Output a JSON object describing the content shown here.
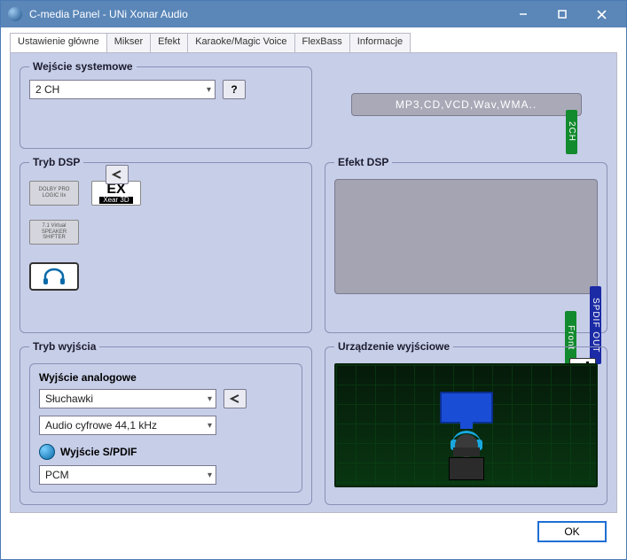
{
  "window": {
    "title": "C-media Panel - UNi Xonar Audio",
    "icon": "audio-app-icon"
  },
  "tabs": [
    {
      "label": "Ustawienie główne",
      "active": true
    },
    {
      "label": "Mikser"
    },
    {
      "label": "Efekt"
    },
    {
      "label": "Karaoke/Magic Voice"
    },
    {
      "label": "FlexBass"
    },
    {
      "label": "Informacje"
    }
  ],
  "system_input": {
    "legend": "Wejście systemowe",
    "channel_value": "2 CH"
  },
  "formats_text": "MP3,CD,VCD,Wav,WMA..",
  "dsp_mode": {
    "legend": "Tryb DSP",
    "buttons": {
      "dolby": "DOLBY PRO LOGIC IIx",
      "xear_top": "EX",
      "xear_bottom": "Xear 3D",
      "virtual71": "7.1 Virtual SPEAKER SHIFTER"
    }
  },
  "dsp_effect": {
    "legend": "Efekt DSP"
  },
  "connectors": {
    "ch2": "2CH",
    "front": "Front",
    "spdif": "SPDIF OUT"
  },
  "output_mode": {
    "legend": "Tryb wyjścia",
    "analog_label": "Wyjście analogowe",
    "analog_value": "Słuchawki",
    "sample_value": "Audio cyfrowe 44,1 kHz",
    "spdif_label": "Wyjście S/PDIF",
    "spdif_value": "PCM"
  },
  "output_device": {
    "legend": "Urządzenie wyjściowe"
  },
  "footer": {
    "ok": "OK"
  }
}
